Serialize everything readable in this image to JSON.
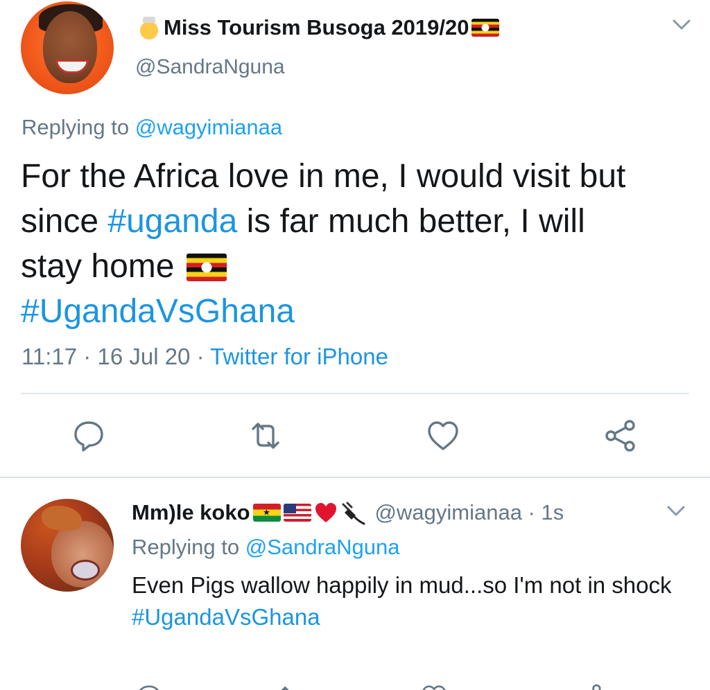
{
  "main_tweet": {
    "display_name": "Miss Tourism Busoga 2019/20",
    "handle": "@SandraNguna",
    "replying_prefix": "Replying to ",
    "replying_to": "@wagyimianaa",
    "text_line_1": "For the Africa love in me, I would visit but",
    "text_line_2_pre": "since ",
    "text_hashtag_1": "#uganda",
    "text_line_2_post": " is far much better, I will",
    "text_line_3": "stay home ",
    "text_hashtag_2": "#UgandaVsGhana",
    "time": "11:17",
    "sep_1": " · ",
    "date": "16 Jul 20",
    "sep_2": " · ",
    "source": "Twitter for iPhone",
    "icons": {
      "name_emoji": "princess-emoji",
      "flag": "uganda-flag-icon",
      "menu": "chevron-down-icon"
    }
  },
  "actions": {
    "reply": "reply-icon",
    "retweet": "retweet-icon",
    "like": "like-icon",
    "share": "share-icon"
  },
  "reply_tweet": {
    "display_name": "Mm)le koko",
    "handle": "@wagyimianaa",
    "time_sep": " · ",
    "time": "1s",
    "replying_prefix": "Replying to ",
    "replying_to": "@SandraNguna",
    "text": "Even Pigs wallow happily in mud...so I'm not in shock",
    "hashtag": "#UgandaVsGhana",
    "icons": {
      "name_emojis": [
        "ghana-flag-icon",
        "usa-flag-icon",
        "red-heart-icon",
        "plug-icon"
      ],
      "menu": "chevron-down-icon"
    }
  },
  "colors": {
    "link": "#1b95e0",
    "muted": "#657786",
    "text": "#14171a",
    "divider": "#e1e8ed",
    "heart": "#e0142e"
  }
}
